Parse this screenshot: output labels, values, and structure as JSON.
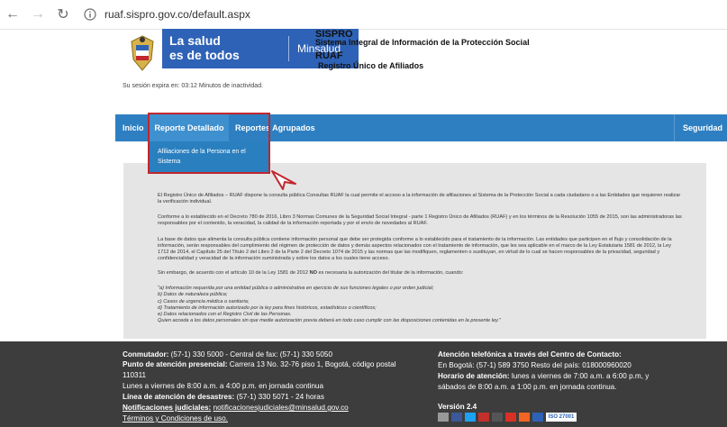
{
  "browser": {
    "url": "ruaf.sispro.gov.co/default.aspx"
  },
  "header": {
    "brand_line1": "La salud",
    "brand_line2": "es de todos",
    "brand_ms": "Minsalud",
    "sispro_title": "SISPRO",
    "sispro_subtitle": "Sistema Integral de Información de la Protección Social",
    "ruaf_title": "RUAF",
    "ruaf_subtitle": "Registro Único de Afiliados"
  },
  "session_text": "Su sesión expira en: 03:12 Minutos de inactividad.",
  "nav": {
    "inicio": "Inicio",
    "reporte_detallado": "Reporte Detallado",
    "reportes_agrupados": "Reportes Agrupados",
    "seguridad": "Seguridad",
    "dropdown_item": "Afiliaciones de la Persona en el Sistema"
  },
  "content": {
    "p1": "El Registro Único de Afiliados – RUAF dispone la consulta pública Consultas RUAF la cual permite el acceso a la información de afiliaciones al Sistema de la Protección Social a cada ciudadano o a las Entidades que requieren realizar la verificación individual.",
    "p2": "Conforme a lo establecido en el Decreto 780 de 2016, Libro 3 Normas Comunes de la Seguridad Social Integral - parte 1 Registro Único de Afiliados (RUAF) y en los términos de la Resolución 1055 de 2015, son las administradoras las responsables por el contenido, la veracidad, la calidad de la información reportada y por el envío de novedades al RUAF.",
    "p3": "La base de datos que alimenta la consulta pública contiene información personal que debe ser protegida conforme a lo establecido para el tratamiento de la información. Las entidades que participen en el flujo y consolidación de la información, serán responsables del cumplimiento del régimen de protección de datos y demás aspectos relacionados con el tratamiento de información, que les sea aplicable en el marco de la Ley Estatutaria 1581 de 2012, la Ley 1712 de 2014, el Capítulo 25 del Título 2 del Libro 2 de la Parte 2 del Decreto 1074 de 2015 y las normas que las modifiquen, reglamenten o sustituyan, en virtud de lo cual se hacen responsables de la privacidad, seguridad y confidencialidad y veracidad de la información suministrada y sobre los datos a los cuales tiene acceso.",
    "p4_before": "Sin embargo, de acuerdo con el artículo 10 de la Ley 1581 de 2012 ",
    "p4_bold": "NO",
    "p4_after": " es necesaria la autorización del titular de la información, cuando:",
    "list": [
      "\"a) Información requerida por una entidad pública o administrativa en ejercicio de sus funciones legales o por orden judicial;",
      "b) Datos de naturaleza pública;",
      "c) Casos de urgencia médica o sanitaria;",
      "d) Tratamiento de información autorizado por la ley para fines históricos, estadísticos o científicos;",
      "e) Datos relacionados con el Registro Civil de las Personas.",
      "Quien acceda a los datos personales sin que medie autorización previa deberá en todo caso cumplir con las disposiciones contenidas en la presente ley.\""
    ]
  },
  "footer": {
    "conmutador_label": "Conmutador:",
    "conmutador_value": " (57-1) 330 5000 - Central de fax: (57-1) 330 5050",
    "punto_label": "Punto de atención presencial:",
    "punto_value": " Carrera 13 No. 32-76 piso 1, Bogotá, código postal",
    "punto_cont": "110311",
    "horario_left": "Lunes a viernes de 8:00 a.m. a 4:00 p.m. en jornada continua",
    "desastres_label": "Línea de atención de desastres:",
    "desastres_value": " (57-1) 330 5071 - 24 horas",
    "notif_label": "Notificaciones judiciales:",
    "notif_value": "notificacionesjudiciales@minsalud.gov.co",
    "terminos": "Términos y Condiciones de uso.",
    "atencion_label": "Atención telefónica a través del Centro de Contacto:",
    "bogota": "En Bogotá: (57-1) 589 3750 Resto del país: 018000960020",
    "horario_label": "Horario de atención:",
    "horario_value": " lunes a viernes de 7:00 a.m. a 6:00 p.m, y",
    "horario_cont": "sábados de 8:00 a.m. a 1:00 p.m. en jornada continua.",
    "version": "Versión 2.4",
    "iso": "ISO 27001"
  },
  "colors": {
    "nav_blue": "#2e7fc1",
    "brand_blue": "#2e62b6",
    "highlight_red": "#c1272d",
    "footer_bg": "#3d3d3d",
    "content_bg": "#e5e5e5"
  }
}
